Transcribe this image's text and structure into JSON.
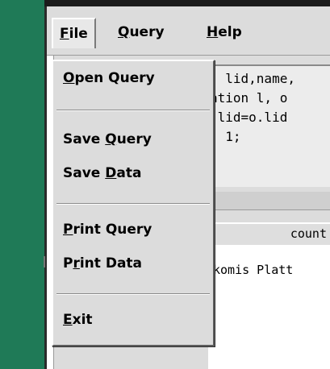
{
  "menubar": {
    "file_label": "File",
    "query_label": "Query",
    "help_label": "Help"
  },
  "file_menu": {
    "items": [
      {
        "label": "Open Query"
      },
      {
        "label": "Save Query"
      },
      {
        "label": "Save Data"
      },
      {
        "label": "Print Query"
      },
      {
        "label": "Print Data"
      },
      {
        "label": "Exit"
      }
    ]
  },
  "query_text": {
    "lines": [
      ". lid,name,",
      "ation l, o",
      " lid=o.lid ",
      "- 1;"
    ]
  },
  "results": {
    "column_header": "count",
    "first_row": "komis Platt"
  },
  "colors": {
    "desktop_green": "#1f7a57",
    "window_gray": "#dcdcdc"
  }
}
